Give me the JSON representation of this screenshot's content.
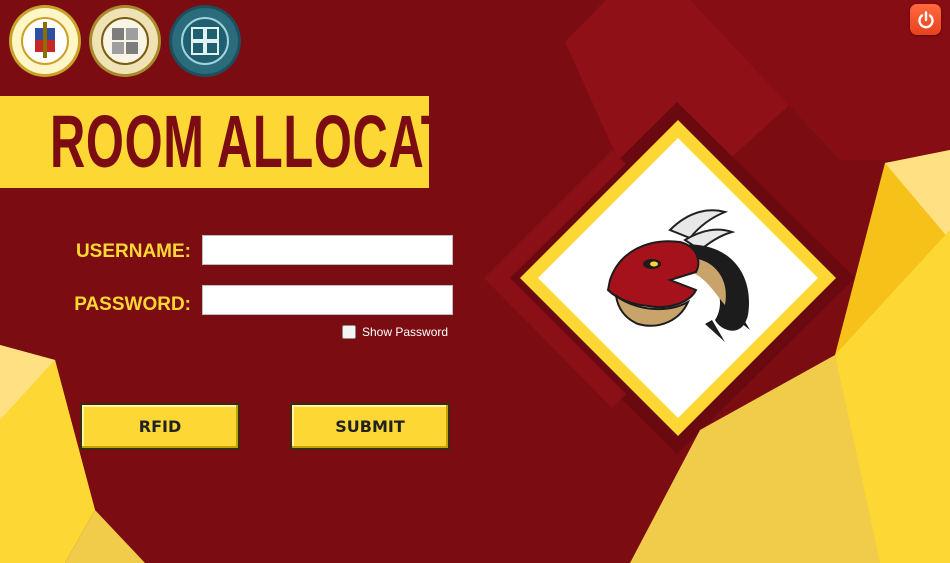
{
  "window": {
    "logos": [
      "university-of-bohol-seal",
      "college-of-engineering-technology-seal",
      "computer-engineering-seal"
    ],
    "power_icon": "power-icon"
  },
  "header": {
    "title": "ROOM ALLOCATOR"
  },
  "form": {
    "username_label": "USERNAME:",
    "username_value": "",
    "password_label": "PASSWORD:",
    "password_value": "",
    "show_password_label": "Show Password",
    "show_password_checked": false
  },
  "buttons": {
    "rfid_label": "RFID",
    "submit_label": "SUBMIT"
  },
  "emblem": {
    "icon": "dragon-head-icon"
  },
  "colors": {
    "background": "#7a0c12",
    "accent_yellow": "#fdd835",
    "power_button": "#e8421c"
  }
}
